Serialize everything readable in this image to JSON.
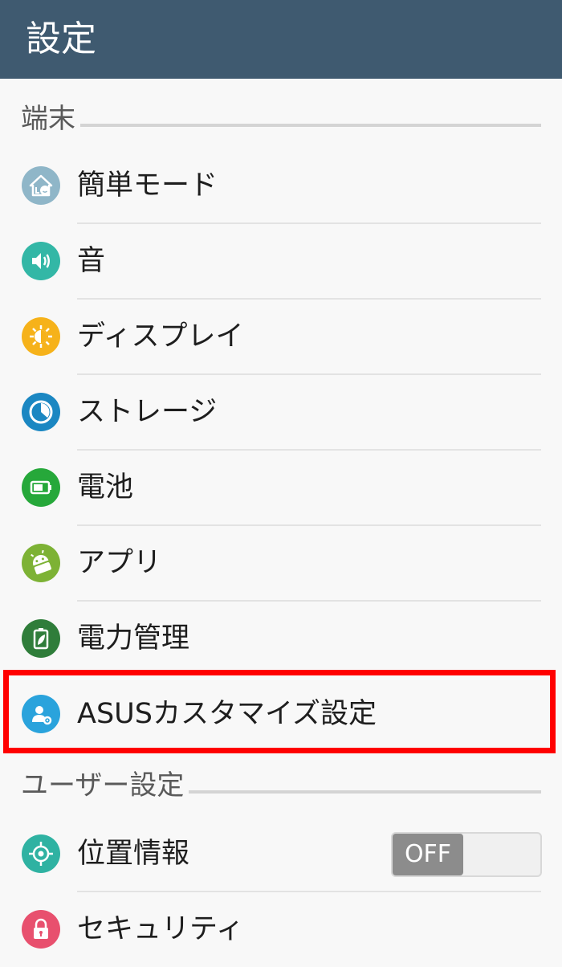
{
  "header": {
    "title": "設定"
  },
  "sections": {
    "device": {
      "label": "端末"
    },
    "user": {
      "label": "ユーザー設定"
    }
  },
  "items": {
    "easy_mode": {
      "label": "簡単モード",
      "icon": "home-face-icon",
      "color": "#8fb6c8"
    },
    "sound": {
      "label": "音",
      "icon": "speaker-icon",
      "color": "#33b7a6"
    },
    "display": {
      "label": "ディスプレイ",
      "icon": "sun-icon",
      "color": "#f6b21a"
    },
    "storage": {
      "label": "ストレージ",
      "icon": "pie-chart-icon",
      "color": "#1b87c2"
    },
    "battery": {
      "label": "電池",
      "icon": "battery-icon",
      "color": "#26a83a"
    },
    "apps": {
      "label": "アプリ",
      "icon": "android-icon",
      "color": "#7db235"
    },
    "power": {
      "label": "電力管理",
      "icon": "leaf-battery-icon",
      "color": "#2f7d3a"
    },
    "asus": {
      "label": "ASUSカスタマイズ設定",
      "icon": "user-gear-icon",
      "color": "#2aa3dc"
    },
    "location": {
      "label": "位置情報",
      "icon": "crosshair-icon",
      "color": "#2fb2a2",
      "toggle": "OFF"
    },
    "security": {
      "label": "セキュリティ",
      "icon": "lock-icon",
      "color": "#e8506e"
    }
  },
  "highlight_color": "#ff0000"
}
